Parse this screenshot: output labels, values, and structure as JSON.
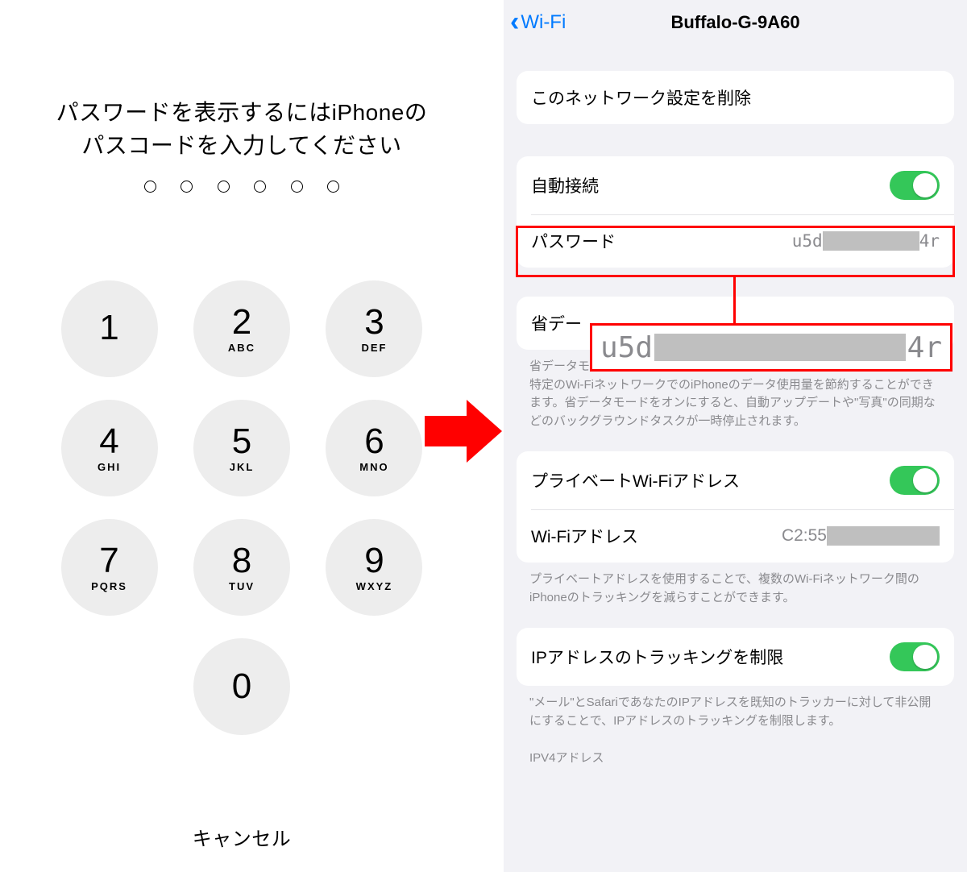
{
  "left": {
    "prompt_line1": "パスワードを表示するにはiPhoneの",
    "prompt_line2": "パスコードを入力してください",
    "passcode_length": 6,
    "keys": [
      {
        "digit": "1",
        "letters": ""
      },
      {
        "digit": "2",
        "letters": "ABC"
      },
      {
        "digit": "3",
        "letters": "DEF"
      },
      {
        "digit": "4",
        "letters": "GHI"
      },
      {
        "digit": "5",
        "letters": "JKL"
      },
      {
        "digit": "6",
        "letters": "MNO"
      },
      {
        "digit": "7",
        "letters": "PQRS"
      },
      {
        "digit": "8",
        "letters": "TUV"
      },
      {
        "digit": "9",
        "letters": "WXYZ"
      },
      {
        "digit": "0",
        "letters": ""
      }
    ],
    "cancel": "キャンセル"
  },
  "annotation": {
    "arrow_color": "#ff0000"
  },
  "right": {
    "nav": {
      "back": "Wi-Fi",
      "title": "Buffalo-G-9A60"
    },
    "forget_network": "このネットワーク設定を削除",
    "auto_join": {
      "label": "自動接続",
      "on": true
    },
    "password": {
      "label": "パスワード",
      "value_prefix": "u5d",
      "value_suffix": "4r"
    },
    "low_data": {
      "label": "省データモード",
      "label_truncated": "省デー",
      "footer": "省データモードを使用すると、モバイル通信ネットワークまたは選択された特定のWi-FiネットワークでのiPhoneのデータ使用量を節約することができます。省データモードをオンにすると、自動アップデートや\"写真\"の同期などのバックグラウンドタスクが一時停止されます。"
    },
    "zoom": {
      "prefix": "u5d",
      "suffix": "4r"
    },
    "private_addr": {
      "label": "プライベートWi-Fiアドレス",
      "on": true
    },
    "wifi_addr": {
      "label": "Wi-Fiアドレス",
      "value_prefix": "C2:55"
    },
    "private_addr_footer": "プライベートアドレスを使用することで、複数のWi-Fiネットワーク間のiPhoneのトラッキングを減らすことができます。",
    "limit_tracking": {
      "label": "IPアドレスのトラッキングを制限",
      "on": true
    },
    "limit_tracking_footer": "\"メール\"とSafariであなたのIPアドレスを既知のトラッカーに対して非公開にすることで、IPアドレスのトラッキングを制限します。",
    "ipv4_header": "IPV4アドレス"
  }
}
